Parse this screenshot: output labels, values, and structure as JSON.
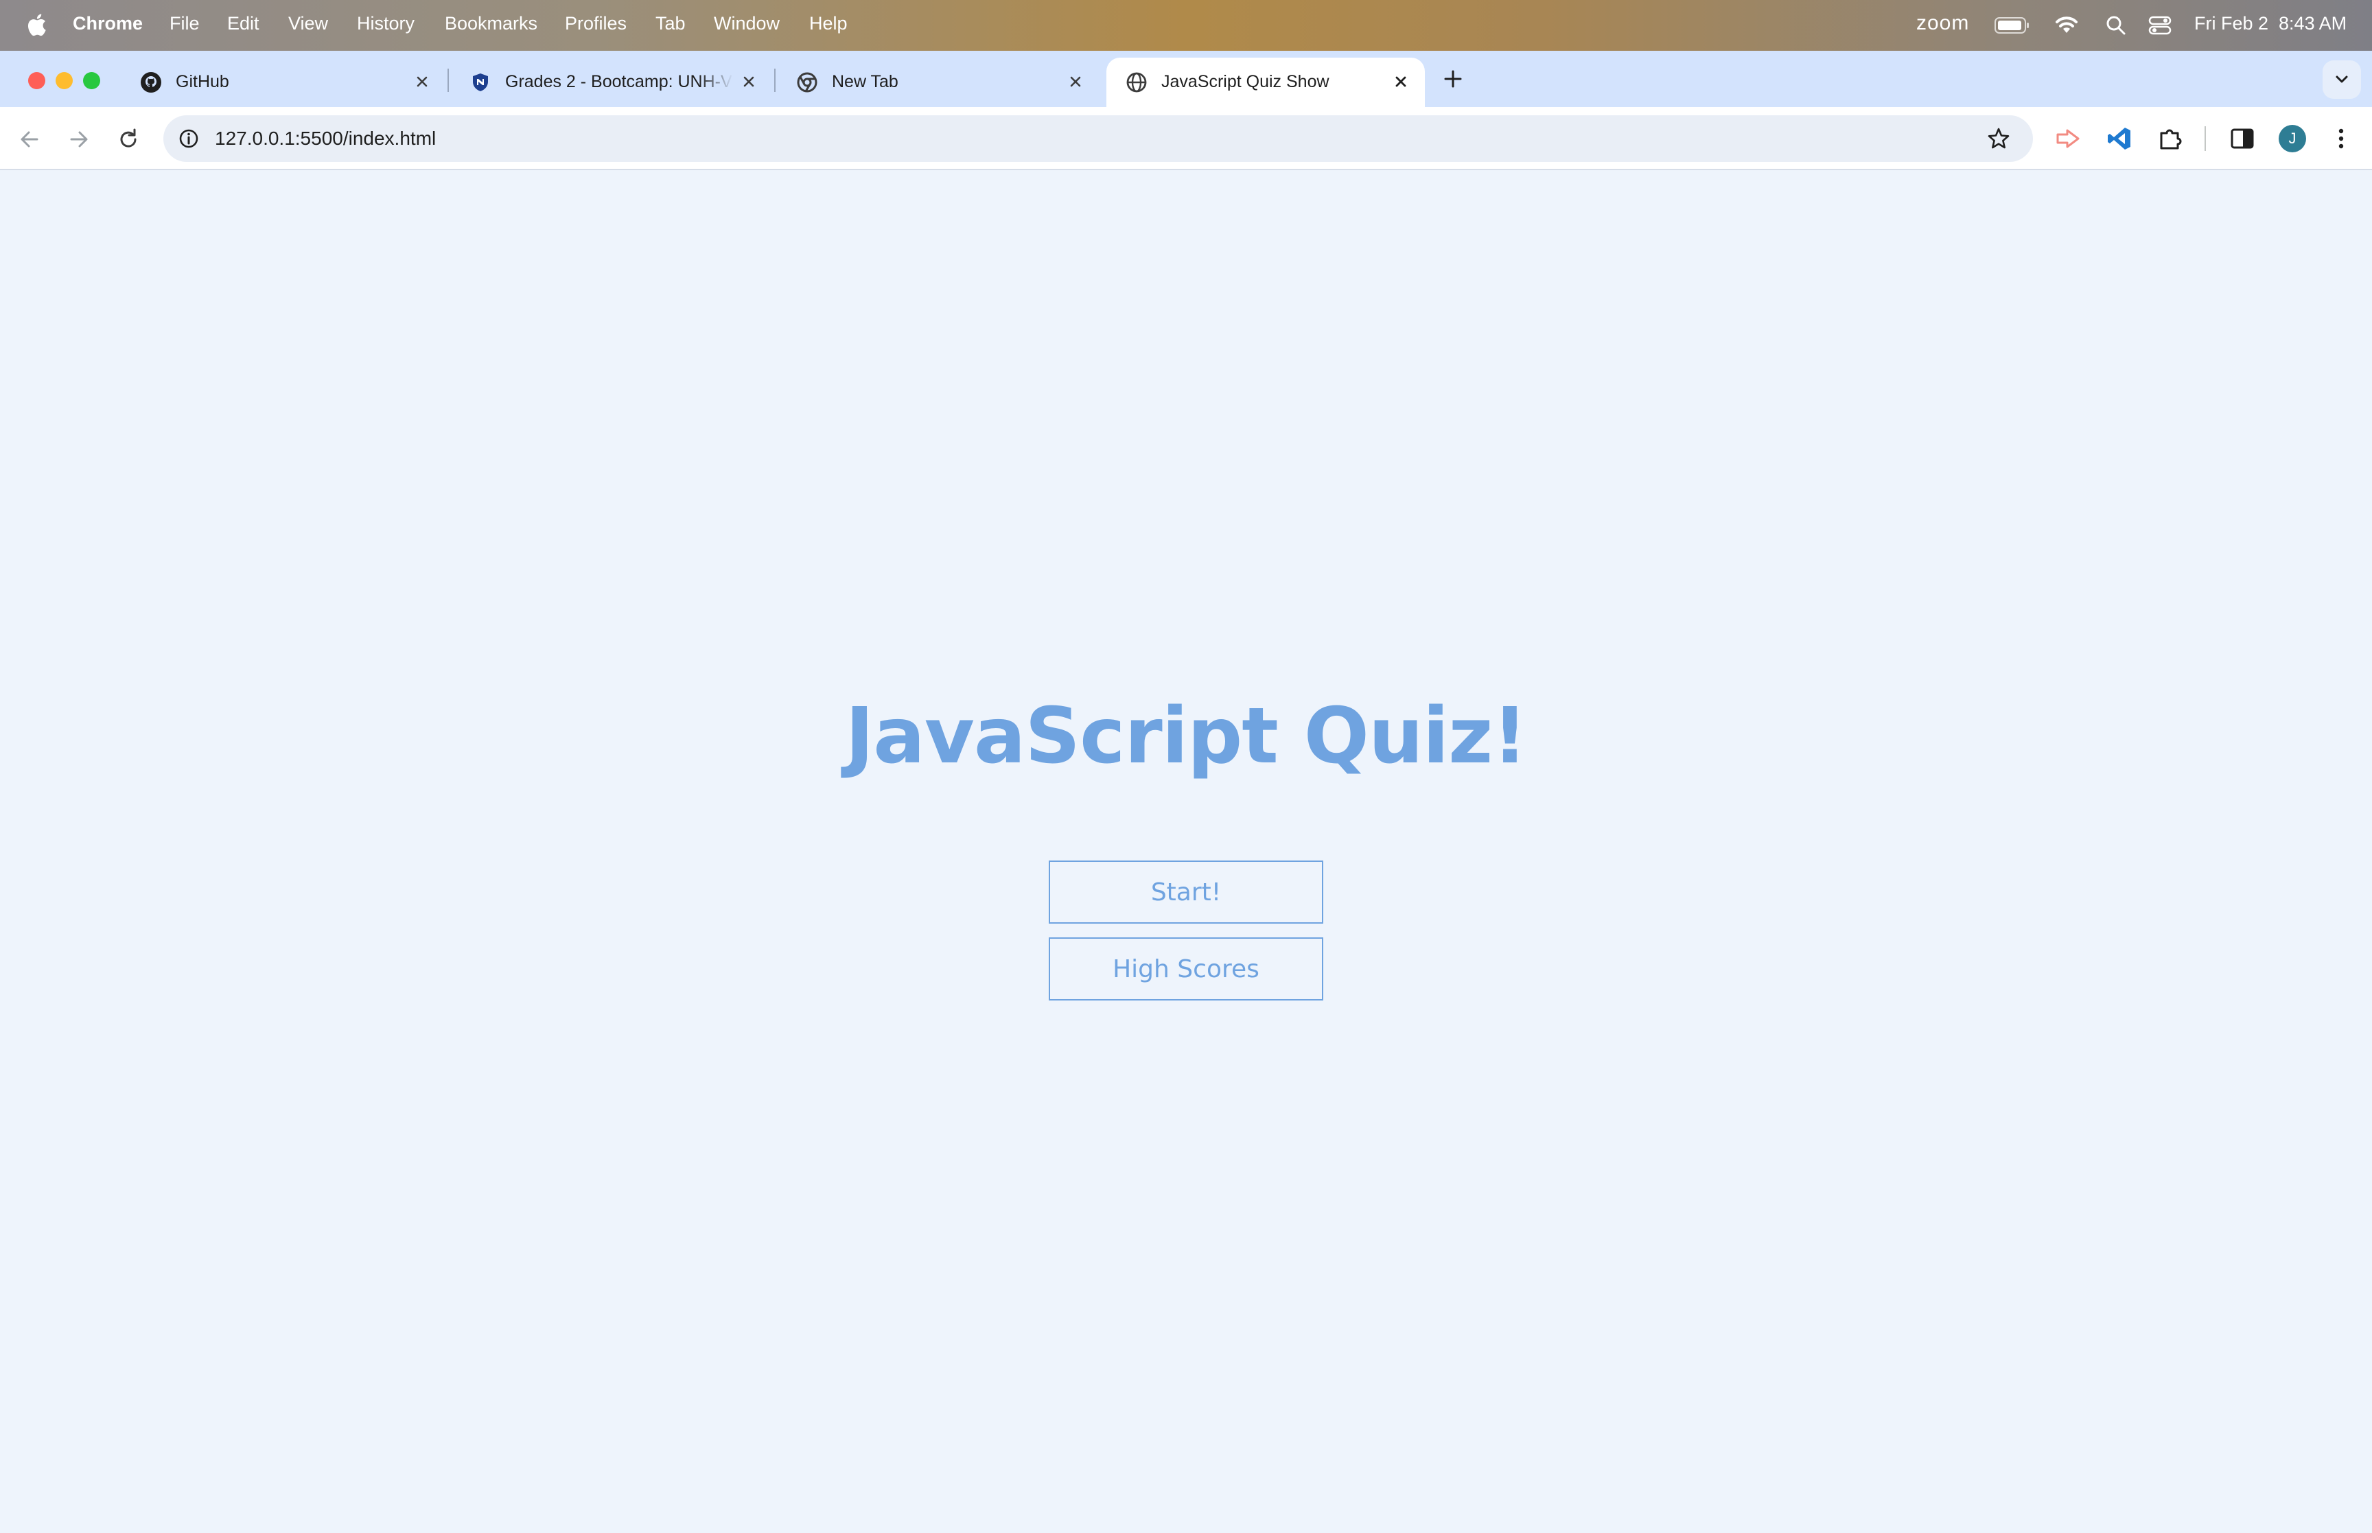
{
  "menubar": {
    "app": "Chrome",
    "items": [
      "File",
      "Edit",
      "View",
      "History",
      "Bookmarks",
      "Profiles",
      "Tab",
      "Window",
      "Help"
    ],
    "zoom_label": "zoom",
    "datetime": "Fri Feb 2  8:43 AM"
  },
  "tabs": [
    {
      "title": "GitHub",
      "icon": "github-icon"
    },
    {
      "title": "Grades 2 - Bootcamp: UNH-V",
      "icon": "shield-icon"
    },
    {
      "title": "New Tab",
      "icon": "chrome-icon"
    },
    {
      "title": "JavaScript Quiz Show",
      "icon": "globe-icon",
      "active": true
    }
  ],
  "toolbar": {
    "url": "127.0.0.1:5500/index.html",
    "profile_initial": "J"
  },
  "page": {
    "title": "JavaScript Quiz!",
    "start_label": "Start!",
    "highscores_label": "High Scores"
  },
  "colors": {
    "accent": "#6fa3e0",
    "page_bg": "#eef4fc",
    "tabstrip_bg": "#d3e3fd"
  }
}
